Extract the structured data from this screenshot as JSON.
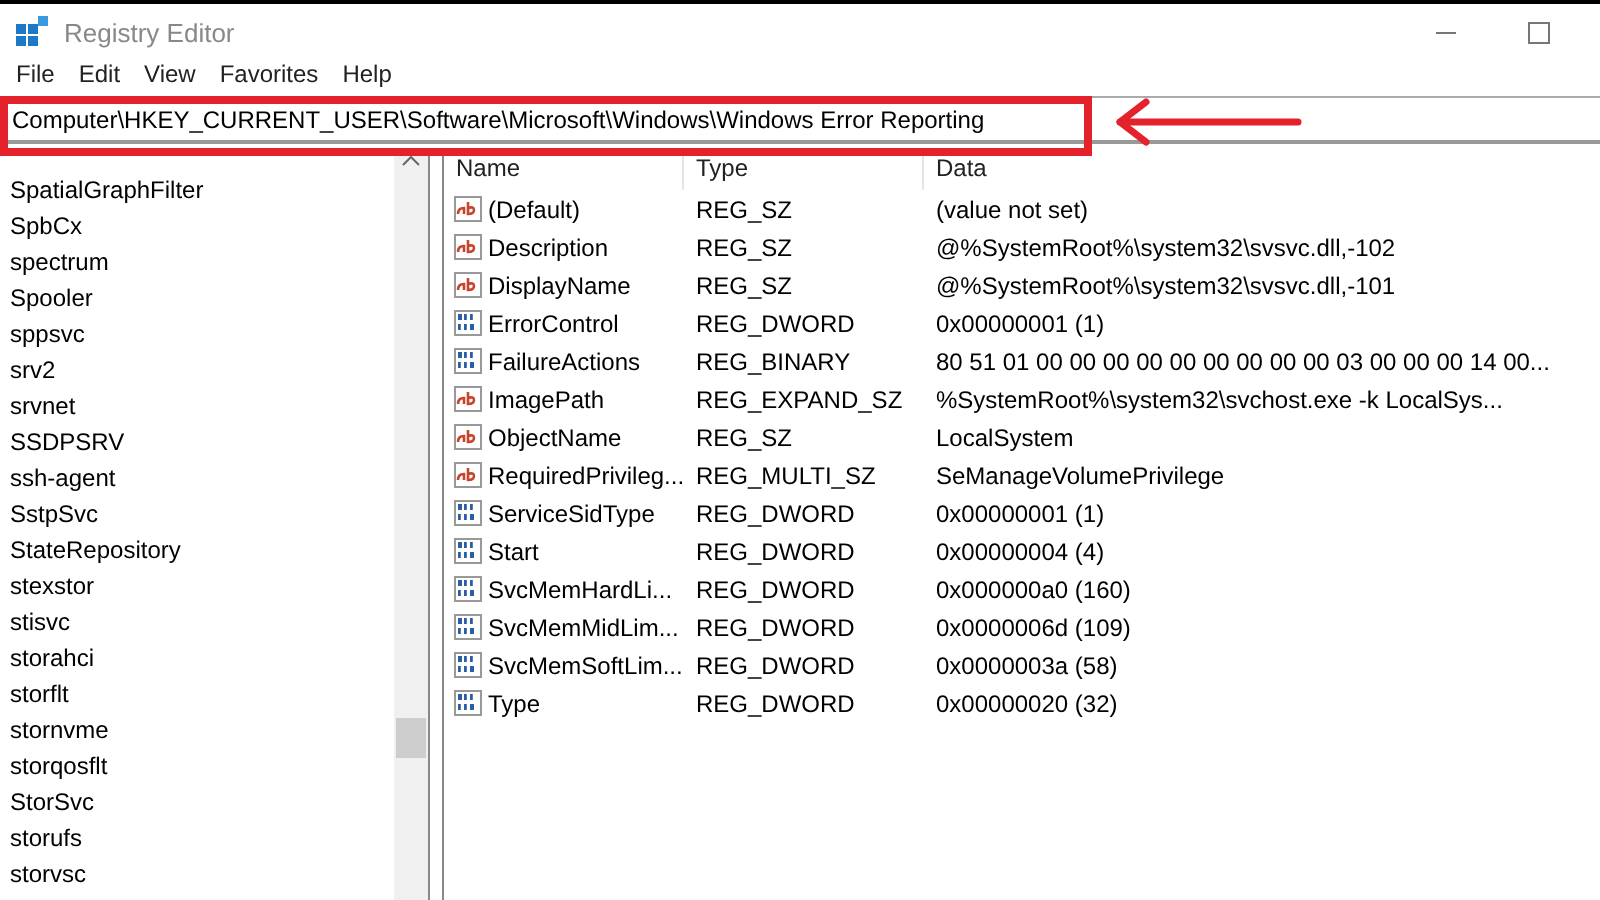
{
  "window": {
    "title": "Registry Editor"
  },
  "menu": [
    "File",
    "Edit",
    "View",
    "Favorites",
    "Help"
  ],
  "address": {
    "value": "Computer\\HKEY_CURRENT_USER\\Software\\Microsoft\\Windows\\Windows Error Reporting"
  },
  "tree": {
    "items": [
      "SpatialGraphFilter",
      "SpbCx",
      "spectrum",
      "Spooler",
      "sppsvc",
      "srv2",
      "srvnet",
      "SSDPSRV",
      "ssh-agent",
      "SstpSvc",
      "StateRepository",
      "stexstor",
      "stisvc",
      "storahci",
      "storflt",
      "stornvme",
      "storqosflt",
      "StorSvc",
      "storufs",
      "storvsc"
    ]
  },
  "values": {
    "columns": [
      "Name",
      "Type",
      "Data"
    ],
    "rows": [
      {
        "kind": "string",
        "name": "(Default)",
        "type": "REG_SZ",
        "data": "(value not set)"
      },
      {
        "kind": "string",
        "name": "Description",
        "type": "REG_SZ",
        "data": "@%SystemRoot%\\system32\\svsvc.dll,-102"
      },
      {
        "kind": "string",
        "name": "DisplayName",
        "type": "REG_SZ",
        "data": "@%SystemRoot%\\system32\\svsvc.dll,-101"
      },
      {
        "kind": "binary",
        "name": "ErrorControl",
        "type": "REG_DWORD",
        "data": "0x00000001 (1)"
      },
      {
        "kind": "binary",
        "name": "FailureActions",
        "type": "REG_BINARY",
        "data": "80 51 01 00 00 00 00 00 00 00 00 00 03 00 00 00 14 00..."
      },
      {
        "kind": "string",
        "name": "ImagePath",
        "type": "REG_EXPAND_SZ",
        "data": "%SystemRoot%\\system32\\svchost.exe -k LocalSys..."
      },
      {
        "kind": "string",
        "name": "ObjectName",
        "type": "REG_SZ",
        "data": "LocalSystem"
      },
      {
        "kind": "string",
        "name": "RequiredPrivileg...",
        "type": "REG_MULTI_SZ",
        "data": "SeManageVolumePrivilege"
      },
      {
        "kind": "binary",
        "name": "ServiceSidType",
        "type": "REG_DWORD",
        "data": "0x00000001 (1)"
      },
      {
        "kind": "binary",
        "name": "Start",
        "type": "REG_DWORD",
        "data": "0x00000004 (4)"
      },
      {
        "kind": "binary",
        "name": "SvcMemHardLi...",
        "type": "REG_DWORD",
        "data": "0x000000a0 (160)"
      },
      {
        "kind": "binary",
        "name": "SvcMemMidLim...",
        "type": "REG_DWORD",
        "data": "0x0000006d (109)"
      },
      {
        "kind": "binary",
        "name": "SvcMemSoftLim...",
        "type": "REG_DWORD",
        "data": "0x0000003a (58)"
      },
      {
        "kind": "binary",
        "name": "Type",
        "type": "REG_DWORD",
        "data": "0x00000020 (32)"
      }
    ]
  }
}
